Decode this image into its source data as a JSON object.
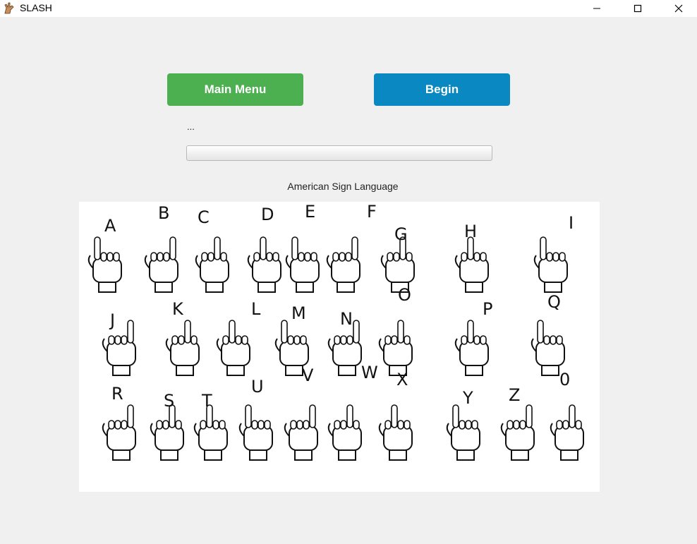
{
  "window": {
    "title": "SLASH",
    "app_icon": "hand-sign-icon"
  },
  "window_controls": {
    "minimize": "minimize-icon",
    "maximize": "maximize-icon",
    "close": "close-icon"
  },
  "buttons": {
    "main_menu": {
      "label": "Main Menu",
      "color": "#4caf50"
    },
    "begin": {
      "label": "Begin",
      "color": "#0a88c2"
    }
  },
  "status": {
    "text": "..."
  },
  "progress": {
    "value": 0
  },
  "chart": {
    "caption": "American Sign Language",
    "letters": [
      "A",
      "B",
      "C",
      "D",
      "E",
      "F",
      "G",
      "H",
      "I",
      "J",
      "K",
      "L",
      "M",
      "N",
      "O",
      "P",
      "Q",
      "R",
      "S",
      "T",
      "U",
      "V",
      "W",
      "X",
      "Y",
      "Z",
      "0"
    ]
  }
}
